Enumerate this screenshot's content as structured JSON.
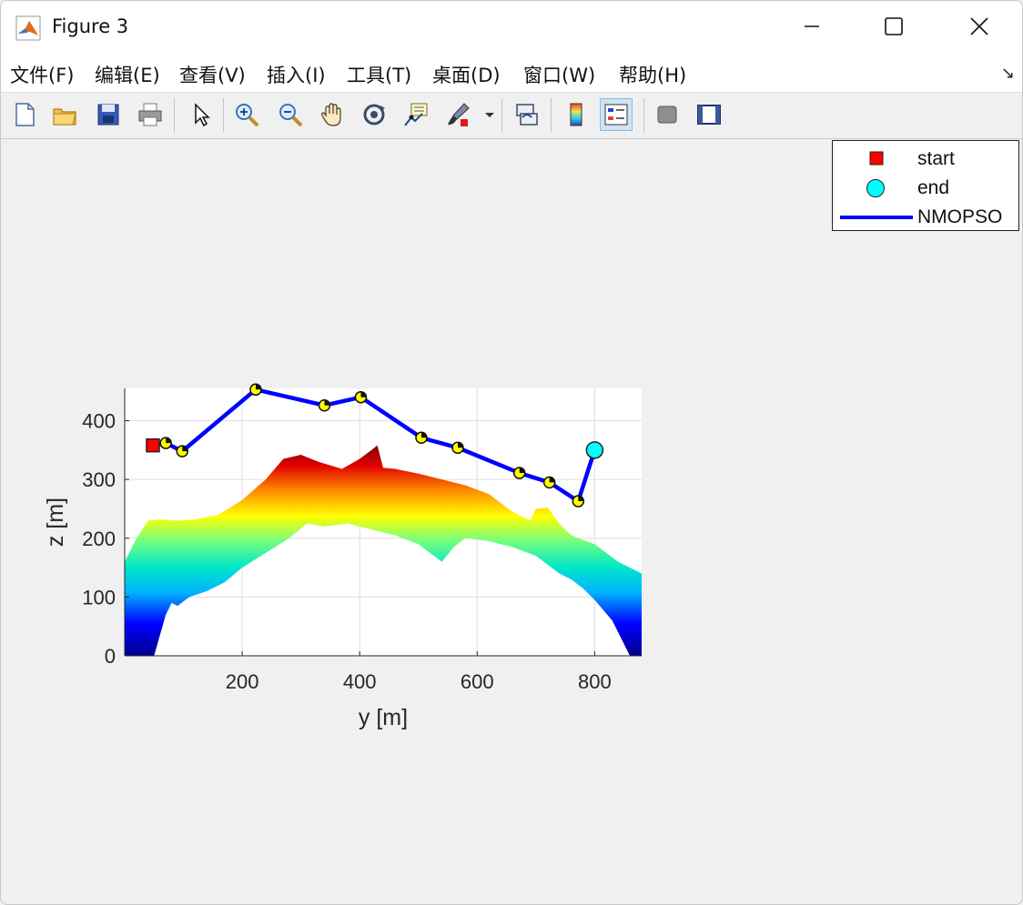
{
  "window": {
    "title": "Figure 3"
  },
  "menu": {
    "items": [
      "文件(F)",
      "编辑(E)",
      "查看(V)",
      "插入(I)",
      "工具(T)",
      "桌面(D)",
      "窗口(W)",
      "帮助(H)"
    ]
  },
  "toolbar": {
    "icons": [
      "new-figure-icon",
      "open-file-icon",
      "save-icon",
      "print-icon",
      "pointer-icon",
      "zoom-in-icon",
      "zoom-out-icon",
      "pan-icon",
      "rotate-3d-icon",
      "data-cursor-icon",
      "brush-icon",
      "link-plot-icon",
      "colorbar-icon",
      "legend-icon",
      "hide-plot-tools-icon",
      "show-plot-tools-icon"
    ]
  },
  "legend": {
    "entries": [
      {
        "label": "start",
        "marker": "square",
        "color": "#ff0000"
      },
      {
        "label": "end",
        "marker": "circle",
        "color": "#00ffff"
      },
      {
        "label": "NMOPSO",
        "marker": "line",
        "color": "#0000ff"
      }
    ]
  },
  "chart_data": {
    "type": "line",
    "xlabel": "y [m]",
    "ylabel": "z [m]",
    "xlim": [
      0,
      880
    ],
    "ylim": [
      0,
      455
    ],
    "xticks": [
      200,
      400,
      600,
      800
    ],
    "yticks": [
      0,
      100,
      200,
      300,
      400
    ],
    "grid": true,
    "legend_position": "top-right",
    "start": {
      "x": 48,
      "y": 358,
      "color": "#ff0000"
    },
    "end": {
      "x": 800,
      "y": 350,
      "color": "#00ffff"
    },
    "path": {
      "name": "NMOPSO",
      "color": "#0000ff",
      "waypoint_color": "#ffff00",
      "x": [
        48,
        70,
        98,
        223,
        340,
        402,
        505,
        567,
        672,
        723,
        772,
        800
      ],
      "y": [
        358,
        362,
        348,
        453,
        426,
        440,
        371,
        354,
        311,
        295,
        263,
        350
      ]
    },
    "terrain": {
      "colormap": "jet",
      "top_profile": {
        "x": [
          0,
          20,
          40,
          60,
          90,
          120,
          160,
          200,
          240,
          270,
          300,
          330,
          370,
          400,
          420,
          430,
          440,
          460,
          500,
          540,
          580,
          620,
          660,
          690,
          700,
          720,
          740,
          760,
          800,
          840,
          880
        ],
        "y": [
          160,
          200,
          230,
          232,
          230,
          232,
          240,
          265,
          300,
          335,
          342,
          330,
          318,
          335,
          350,
          358,
          320,
          318,
          310,
          300,
          290,
          275,
          245,
          230,
          250,
          252,
          225,
          205,
          190,
          160,
          140
        ]
      },
      "bottom_profile": {
        "x": [
          0,
          50,
          70,
          80,
          90,
          110,
          140,
          170,
          200,
          240,
          280,
          310,
          340,
          380,
          420,
          460,
          500,
          540,
          560,
          580,
          620,
          660,
          700,
          740,
          760,
          780,
          800,
          830,
          850,
          860,
          880
        ],
        "y": [
          0,
          0,
          70,
          90,
          85,
          100,
          110,
          125,
          150,
          175,
          200,
          225,
          220,
          225,
          215,
          205,
          190,
          160,
          185,
          200,
          195,
          185,
          170,
          140,
          130,
          115,
          95,
          60,
          20,
          0,
          0
        ]
      }
    }
  }
}
